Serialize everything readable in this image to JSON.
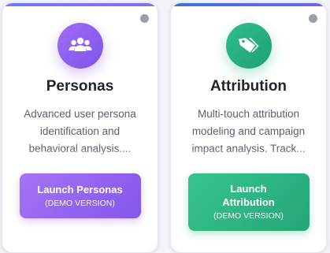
{
  "cards": [
    {
      "title": "Personas",
      "icon": "users-icon",
      "description": "Advanced user persona identification and behavioral analysis.... Leverage behavioral",
      "button_label": "Launch Personas",
      "button_sub": "(DEMO VERSION)",
      "accent": "#8b5cf6"
    },
    {
      "title": "Attribution",
      "icon": "tags-icon",
      "description": "Multi-touch attribution modeling and campaign impact analysis. Track... marketing channels",
      "button_label": "Launch Attribution",
      "button_sub": "(DEMO VERSION)",
      "accent": "#2bb582"
    }
  ]
}
